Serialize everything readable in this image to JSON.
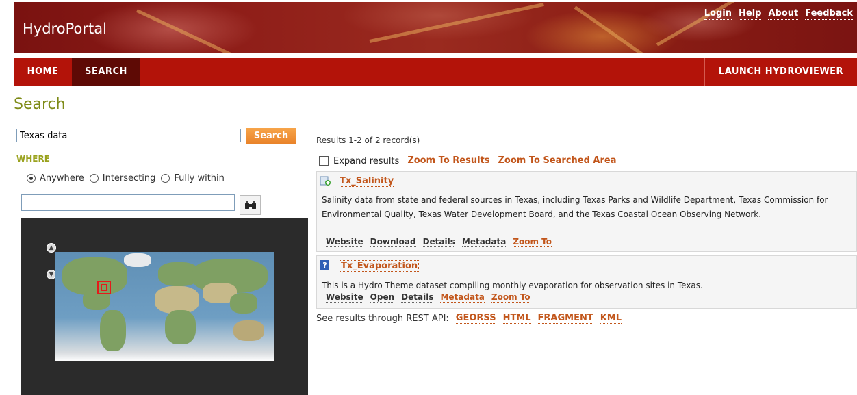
{
  "header": {
    "brand": "HydroPortal",
    "top_links": [
      "Login",
      "Help",
      "About",
      "Feedback"
    ]
  },
  "nav": {
    "home": "HOME",
    "search": "SEARCH",
    "launch": "LAUNCH HYDROVIEWER"
  },
  "page_title": "Search",
  "search": {
    "value": "Texas data",
    "button": "Search",
    "where_label": "WHERE",
    "radios": [
      {
        "label": "Anywhere",
        "checked": true
      },
      {
        "label": "Intersecting",
        "checked": false
      },
      {
        "label": "Fully within",
        "checked": false
      }
    ],
    "location_value": "",
    "find_icon": "binoculars-icon"
  },
  "results": {
    "count_text": "Results 1-2 of 2 record(s)",
    "expand_label": "Expand results",
    "zoom_results": "Zoom To Results",
    "zoom_searched": "Zoom To Searched Area",
    "items": [
      {
        "title": "Tx_Salinity",
        "icon": "document-add-icon",
        "description": "Salinity data from state and federal sources in Texas, including Texas Parks and Wildlife Department, Texas Commission for Environmental Quality, Texas Water Development Board, and the Texas Coastal Ocean Observing Network.",
        "actions": [
          "Website",
          "Download",
          "Details",
          "Metadata",
          "Zoom To"
        ]
      },
      {
        "title": "Tx_Evaporation",
        "icon": "help-icon",
        "description": "This is a Hydro Theme dataset compiling monthly evaporation for observation sites in Texas.",
        "actions": [
          "Website",
          "Open",
          "Details",
          "Metadata",
          "Zoom To"
        ]
      }
    ],
    "rest_label": "See results through REST API:",
    "rest_links": [
      "GEORSS",
      "HTML",
      "FRAGMENT",
      "KML"
    ]
  },
  "colors": {
    "nav_red": "#b31309",
    "nav_active": "#5e0a05",
    "title_olive": "#7d8a16",
    "link_orange": "#c2561b",
    "search_button": "#e9832a"
  }
}
